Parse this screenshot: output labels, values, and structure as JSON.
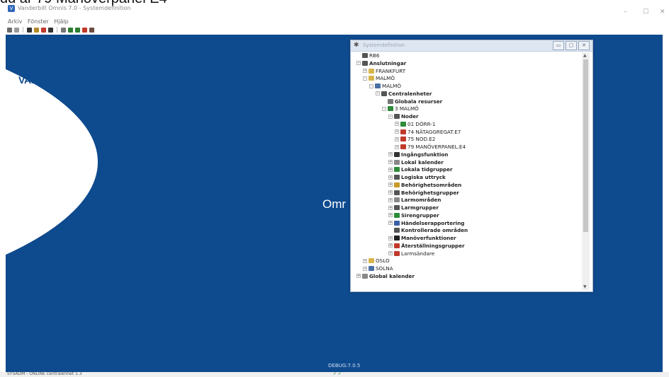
{
  "document": {
    "caption": "dd ar 79 Manöverpanel E4"
  },
  "window": {
    "title": "Vanderbilt Omnis 7.0 - Systemdefinition",
    "buttons": {
      "minimize": "–",
      "maximize": "☐",
      "close": "✕"
    }
  },
  "menu": {
    "items": [
      {
        "label": "Arkiv"
      },
      {
        "label": "Fönster"
      },
      {
        "label": "Hjälp"
      }
    ]
  },
  "toolbar": {
    "buttons": [
      {
        "icon": "save-icon",
        "color": "#6a6a6a"
      },
      {
        "icon": "print-icon",
        "color": "#9a9a9a"
      },
      {
        "icon": "key-icon",
        "color": "#333333"
      },
      {
        "icon": "door-icon",
        "color": "#b58b2a"
      },
      {
        "icon": "alarm-icon",
        "color": "#c0392b"
      },
      {
        "icon": "tools-icon",
        "color": "#333333"
      },
      {
        "icon": "settings-icon",
        "color": "#777777"
      },
      {
        "icon": "node-icon",
        "color": "#2e7d32"
      },
      {
        "icon": "person-icon",
        "color": "#2e7d32"
      },
      {
        "icon": "fire-icon",
        "color": "#c0392b"
      },
      {
        "icon": "log-icon",
        "color": "#6d4c41"
      }
    ]
  },
  "workspace": {
    "background": "#0e4a8e",
    "logo": "VANDERBILT",
    "center_text": "Omr",
    "debug": "DEBUG:7.0.5"
  },
  "statusbar": {
    "text": "SYSADM - ONLINE centralenhet 1.3",
    "icons": "✔ ✔"
  },
  "sysdef": {
    "title": "Systemdefinition",
    "buttons": {
      "minimize": "▭",
      "restore": "▢",
      "close": "✕"
    },
    "tree": [
      {
        "label": "RB6",
        "level": 0,
        "expander": "",
        "bold": false,
        "icon_color": "#555555"
      },
      {
        "label": "Anslutningar",
        "level": 0,
        "expander": "–",
        "bold": true,
        "icon_color": "#555555"
      },
      {
        "label": "FRANKFURT",
        "level": 1,
        "expander": "+",
        "bold": false,
        "icon_color": "#d8b44a"
      },
      {
        "label": "MALMÖ",
        "level": 1,
        "expander": "–",
        "bold": false,
        "icon_color": "#d8b44a"
      },
      {
        "label": "MALMÖ",
        "level": 2,
        "expander": "–",
        "bold": false,
        "icon_color": "#4a6fa5"
      },
      {
        "label": "Centralenheter",
        "level": 3,
        "expander": "–",
        "bold": true,
        "icon_color": "#555555"
      },
      {
        "label": "Globala resurser",
        "level": 4,
        "expander": "",
        "bold": true,
        "icon_color": "#777777"
      },
      {
        "label": "3 MALMÖ",
        "level": 4,
        "expander": "–",
        "bold": false,
        "icon_color": "#2e8b3a"
      },
      {
        "label": "Noder",
        "level": 5,
        "expander": "–",
        "bold": true,
        "icon_color": "#555555"
      },
      {
        "label": "01 DÖRR-1",
        "level": 6,
        "expander": "+",
        "bold": false,
        "icon_color": "#2e8b3a"
      },
      {
        "label": "74 NÄTAGGREGAT.E7",
        "level": 6,
        "expander": "+",
        "bold": false,
        "icon_color": "#c0392b"
      },
      {
        "label": "75 NOD.E2",
        "level": 6,
        "expander": "+",
        "bold": false,
        "icon_color": "#c0392b"
      },
      {
        "label": "79 MANÖVERPANEL.E4",
        "level": 6,
        "expander": "+",
        "bold": false,
        "icon_color": "#c0392b"
      },
      {
        "label": "Ingångsfunktion",
        "level": 5,
        "expander": "+",
        "bold": true,
        "icon_color": "#333333"
      },
      {
        "label": "Lokal kalender",
        "level": 5,
        "expander": "+",
        "bold": true,
        "icon_color": "#888888"
      },
      {
        "label": "Lokala tidgrupper",
        "level": 5,
        "expander": "+",
        "bold": true,
        "icon_color": "#2e8b3a"
      },
      {
        "label": "Logiska uttryck",
        "level": 5,
        "expander": "+",
        "bold": true,
        "icon_color": "#555555"
      },
      {
        "label": "Behörighetsområden",
        "level": 5,
        "expander": "+",
        "bold": true,
        "icon_color": "#c79a2a"
      },
      {
        "label": "Behörighetsgrupper",
        "level": 5,
        "expander": "+",
        "bold": true,
        "icon_color": "#555555"
      },
      {
        "label": "Larmområden",
        "level": 5,
        "expander": "+",
        "bold": true,
        "icon_color": "#888888"
      },
      {
        "label": "Larmgrupper",
        "level": 5,
        "expander": "+",
        "bold": true,
        "icon_color": "#555555"
      },
      {
        "label": "Sirengrupper",
        "level": 5,
        "expander": "+",
        "bold": true,
        "icon_color": "#2e8b3a"
      },
      {
        "label": "Händelserapportering",
        "level": 5,
        "expander": "+",
        "bold": true,
        "icon_color": "#3a5fa5"
      },
      {
        "label": "Kontrollerade områden",
        "level": 5,
        "expander": "",
        "bold": true,
        "icon_color": "#555555"
      },
      {
        "label": "Manöverfunktioner",
        "level": 5,
        "expander": "+",
        "bold": true,
        "icon_color": "#222222"
      },
      {
        "label": "Återställningsgrupper",
        "level": 5,
        "expander": "+",
        "bold": true,
        "icon_color": "#c0392b"
      },
      {
        "label": "Larmsändare",
        "level": 5,
        "expander": "+",
        "bold": false,
        "icon_color": "#c0392b"
      },
      {
        "label": "OSLO",
        "level": 1,
        "expander": "+",
        "bold": false,
        "icon_color": "#d8b44a"
      },
      {
        "label": "SOLNA",
        "level": 1,
        "expander": "+",
        "bold": false,
        "icon_color": "#4a6fa5"
      },
      {
        "label": "Global kalender",
        "level": 0,
        "expander": "+",
        "bold": true,
        "icon_color": "#888888"
      }
    ]
  }
}
